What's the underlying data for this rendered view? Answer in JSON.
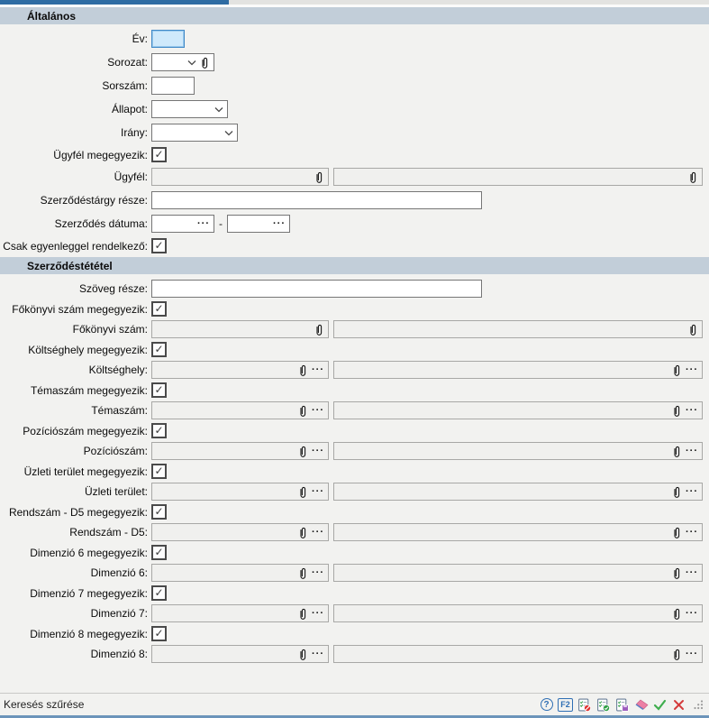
{
  "sections": {
    "general": {
      "title": "Általános"
    },
    "contract_item": {
      "title": "Szerződéstététel"
    }
  },
  "labels": {
    "ev": "Év:",
    "sorozat": "Sorozat:",
    "sorszam": "Sorszám:",
    "allapot": "Állapot:",
    "irany": "Irány:",
    "ugyfel_megegyezik": "Ügyfél megegyezik:",
    "ugyfel": "Ügyfél:",
    "szerzodestargy_resze": "Szerződéstárgy része:",
    "szerzodes_datuma": "Szerződés dátuma:",
    "csak_egyenleggel": "Csak egyenleggel rendelkező:",
    "szoveg_resze": "Szöveg része:",
    "fokonyvi_megegyezik": "Főkönyvi szám megegyezik:",
    "fokonyvi": "Főkönyvi szám:",
    "koltseghely_megegyezik": "Költséghely megegyezik:",
    "koltseghely": "Költséghely:",
    "temaszam_megegyezik": "Témaszám megegyezik:",
    "temaszam": "Témaszám:",
    "pozicioszam_megegyezik": "Pozíciószám megegyezik:",
    "pozicioszam": "Pozíciószám:",
    "uzleti_megegyezik": "Üzleti terület megegyezik:",
    "uzleti": "Üzleti terület:",
    "rendszam_megegyezik": "Rendszám - D5 megegyezik:",
    "rendszam": "Rendszám - D5:",
    "dim6_megegyezik": "Dimenzió 6 megegyezik:",
    "dim6": "Dimenzió 6:",
    "dim7_megegyezik": "Dimenzió 7 megegyezik:",
    "dim7": "Dimenzió 7:",
    "dim8_megegyezik": "Dimenzió 8 megegyezik:",
    "dim8": "Dimenzió 8:"
  },
  "values": {
    "ev": "",
    "sorozat": "",
    "sorszam": "",
    "allapot": "",
    "irany": "",
    "ugyfel_megegyezik": true,
    "ugyfel_kod": "",
    "ugyfel_nev": "",
    "szerzodestargy_resze": "",
    "datum_tol": "",
    "datum_ig": "",
    "csak_egyenleggel": true,
    "szoveg_resze": "",
    "fokonyvi_megegyezik": true,
    "koltseghely_megegyezik": true,
    "temaszam_megegyezik": true,
    "pozicioszam_megegyezik": true,
    "uzleti_megegyezik": true,
    "rendszam_megegyezik": true,
    "dim6_megegyezik": true,
    "dim7_megegyezik": true,
    "dim8_megegyezik": true
  },
  "ui": {
    "check": "✓",
    "ellipsis": "···",
    "date_separator": "-"
  },
  "statusbar": {
    "text": "Keresés szűrése",
    "help_label": "?",
    "f2_label": "F2",
    "icons": [
      "help",
      "f2",
      "filter-list-remove",
      "filter-list-apply",
      "filter-list-save",
      "eraser",
      "accept",
      "cancel",
      "resize-grip"
    ]
  },
  "colors": {
    "section_header_bg": "#c2ced9",
    "active_tab_blue": "#2e6ca3",
    "focused_field_fill": "#cfe9fb",
    "focused_field_border": "#4189c7",
    "accept_green": "#3fae4e",
    "cancel_red": "#d43c3c",
    "help_blue": "#2f6fb4"
  }
}
